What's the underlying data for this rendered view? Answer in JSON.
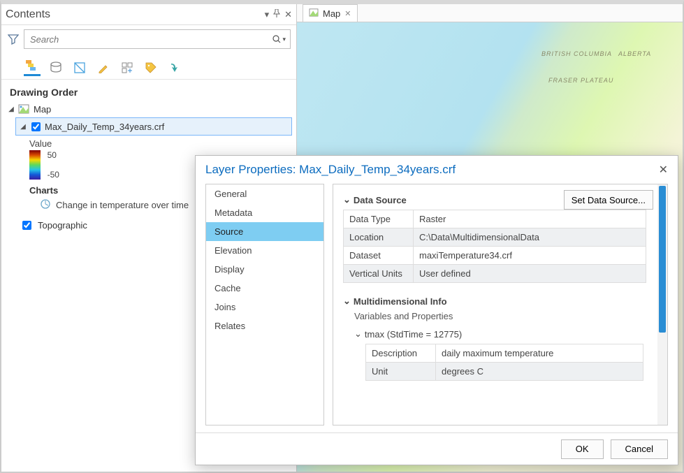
{
  "contents": {
    "title": "Contents",
    "search_placeholder": "Search",
    "drawing_order_label": "Drawing Order",
    "map_label": "Map",
    "layer_name": "Max_Daily_Temp_34years.crf",
    "value_label": "Value",
    "ramp_max": "50",
    "ramp_min": "-50",
    "charts_label": "Charts",
    "chart_item": "Change in temperature over time",
    "topo_label": "Topographic"
  },
  "map_tab": {
    "label": "Map"
  },
  "map_labels": [
    "BRITISH COLUMBIA",
    "ALBERTA",
    "FRASER PLATEAU"
  ],
  "dialog": {
    "title": "Layer Properties: Max_Daily_Temp_34years.crf",
    "nav": [
      "General",
      "Metadata",
      "Source",
      "Elevation",
      "Display",
      "Cache",
      "Joins",
      "Relates"
    ],
    "nav_selected": "Source",
    "set_source_btn": "Set Data Source...",
    "sections": {
      "data_source": {
        "header": "Data Source",
        "rows": [
          {
            "k": "Data Type",
            "v": "Raster"
          },
          {
            "k": "Location",
            "v": "C:\\Data\\MultidimensionalData"
          },
          {
            "k": "Dataset",
            "v": "maxiTemperature34.crf"
          },
          {
            "k": "Vertical Units",
            "v": "User defined"
          }
        ]
      },
      "multi": {
        "header": "Multidimensional Info",
        "sub": "Variables and Properties",
        "tmax_header": "tmax (StdTime = 12775)",
        "rows": [
          {
            "k": "Description",
            "v": "daily maximum temperature"
          },
          {
            "k": "Unit",
            "v": "degrees C"
          }
        ]
      }
    },
    "ok": "OK",
    "cancel": "Cancel"
  }
}
